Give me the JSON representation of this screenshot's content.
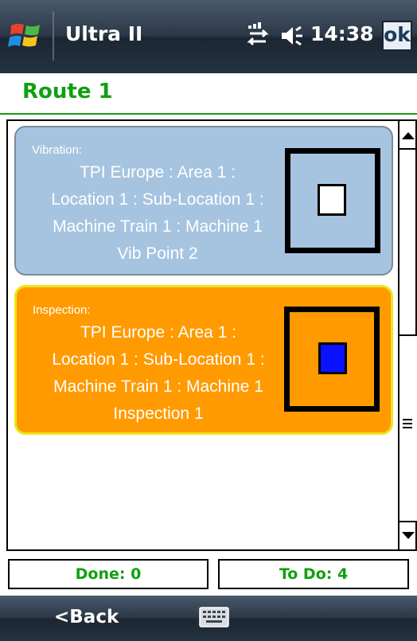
{
  "status_bar": {
    "app_title": "Ultra II",
    "time": "14:38",
    "ok_label": "ok",
    "icons": [
      "windows-start-icon",
      "connectivity-icon",
      "speaker-icon"
    ]
  },
  "page": {
    "title": "Route 1"
  },
  "items": [
    {
      "type_label": "Vibration:",
      "path_lines": [
        "TPI Europe : Area 1 :",
        "Location 1 : Sub-Location 1 :",
        "Machine Train 1 : Machine 1",
        "Vib Point 2"
      ],
      "background": "#a6c4e0",
      "status_color": "#ffffff"
    },
    {
      "type_label": "Inspection:",
      "path_lines": [
        "TPI Europe : Area 1 :",
        "Location 1 : Sub-Location 1 :",
        "Machine Train 1 : Machine 1",
        "Inspection 1"
      ],
      "background": "#ff9a00",
      "status_color": "#0a12ff"
    }
  ],
  "counters": {
    "done": "Done: 0",
    "todo": "To Do: 4"
  },
  "bottom_bar": {
    "back_label": "<Back",
    "keyboard_icon": "keyboard-icon"
  },
  "colors": {
    "accent_green": "#10a010",
    "bar_dark": "#2b3847"
  }
}
